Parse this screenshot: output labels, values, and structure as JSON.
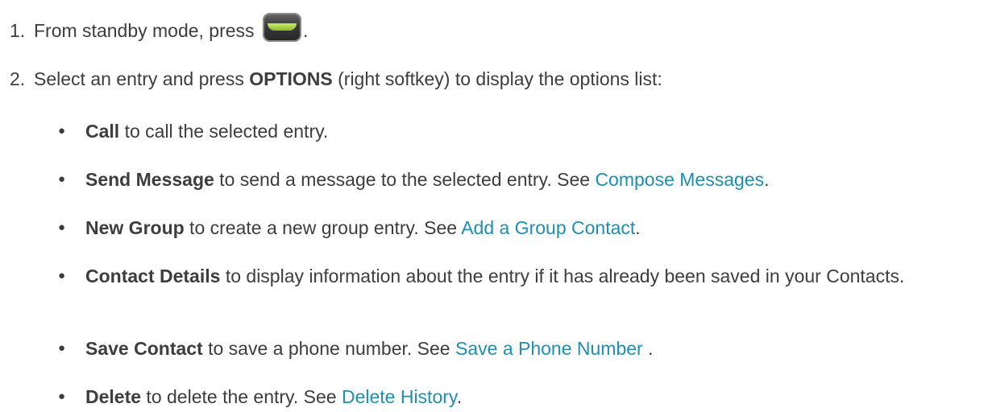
{
  "steps": [
    {
      "number": "1.",
      "text_before": "From standby mode, press",
      "icon": "talk-key-icon",
      "text_after": "."
    },
    {
      "number": "2.",
      "text_before": "Select an entry and press ",
      "bold": "OPTIONS",
      "text_after": " (right softkey) to display the options list:"
    }
  ],
  "bullets": [
    {
      "bold": "Call",
      "text": " to call the selected entry.",
      "link": "",
      "tail": ""
    },
    {
      "bold": "Send Message",
      "text": " to send a message to the selected entry. See ",
      "link": "Compose Messages",
      "tail": "."
    },
    {
      "bold": "New Group",
      "text": " to create a new group entry. See ",
      "link": "Add a Group Contact",
      "tail": "."
    },
    {
      "bold": "Contact Details",
      "text": " to display information about the entry if it has already been saved in your Contacts.",
      "link": "",
      "tail": ""
    },
    {
      "bold": "Save Contact",
      "text": " to save a phone number. See ",
      "link": "Save a Phone Number",
      "tail": " ."
    },
    {
      "bold": "Delete",
      "text": " to delete the entry. See ",
      "link": "Delete History",
      "tail": "."
    }
  ],
  "colors": {
    "text": "#3d3d3d",
    "link": "#1f8fb0",
    "key_accent": "#a6d13c"
  }
}
